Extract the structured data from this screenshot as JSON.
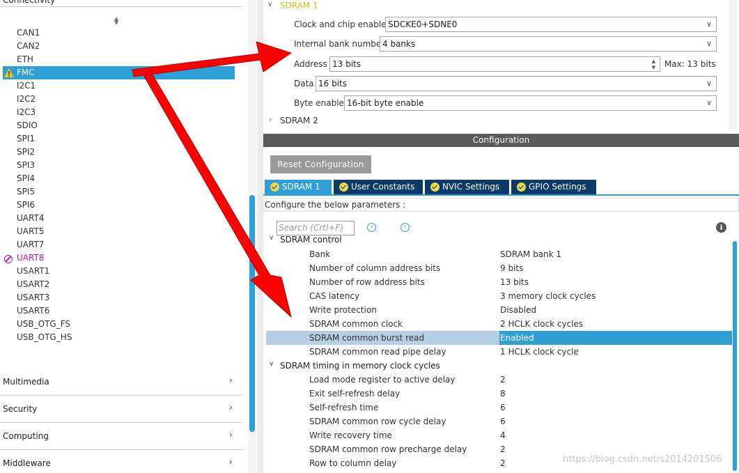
{
  "sidebar": {
    "category_top": "Connectivity",
    "peripherals": [
      "CAN1",
      "CAN2",
      "ETH",
      "FMC",
      "I2C1",
      "I2C2",
      "I2C3",
      "SDIO",
      "SPI1",
      "SPI2",
      "SPI3",
      "SPI4",
      "SPI5",
      "SPI6",
      "UART4",
      "UART5",
      "UART7",
      "UART8",
      "USART1",
      "USART2",
      "USART3",
      "USART6",
      "USB_OTG_FS",
      "USB_OTG_HS"
    ],
    "selected": "FMC",
    "warning_item": "FMC",
    "disabled_item": "UART8",
    "categories": [
      "Multimedia",
      "Security",
      "Computing",
      "Middleware"
    ]
  },
  "sdram1_panel": {
    "title": "SDRAM 1",
    "fields": [
      {
        "label": "Clock and chip enable",
        "value": "SDCKE0+SDNE0",
        "type": "dropdown"
      },
      {
        "label": "Internal bank number",
        "value": "4 banks",
        "type": "dropdown"
      },
      {
        "label": "Address",
        "value": "13 bits",
        "type": "spinner",
        "suffix": "Max: 13 bits"
      },
      {
        "label": "Data",
        "value": "16 bits",
        "type": "dropdown"
      },
      {
        "label": "Byte enable",
        "value": "16-bit byte enable",
        "type": "dropdown"
      }
    ],
    "next_title": "SDRAM 2"
  },
  "config": {
    "header": "Configuration",
    "reset_button": "Reset Configuration",
    "tabs": [
      "SDRAM 1",
      "User Constants",
      "NVIC Settings",
      "GPIO Settings"
    ],
    "active_tab": "SDRAM 1",
    "hint": "Configure the below parameters :",
    "search_placeholder": "Search (Crtl+F)"
  },
  "params": {
    "section1": "SDRAM control",
    "rows1": [
      {
        "name": "Bank",
        "value": "SDRAM bank 1"
      },
      {
        "name": "Number of column address bits",
        "value": "9 bits"
      },
      {
        "name": "Number of row address bits",
        "value": "13 bits"
      },
      {
        "name": "CAS latency",
        "value": "3 memory clock cycles"
      },
      {
        "name": "Write protection",
        "value": "Disabled"
      },
      {
        "name": "SDRAM common clock",
        "value": "2 HCLK clock cycles"
      },
      {
        "name": "SDRAM common burst read",
        "value": "Enabled"
      },
      {
        "name": "SDRAM common read pipe delay",
        "value": "1 HCLK clock cycle"
      }
    ],
    "section2": "SDRAM timing in memory clock cycles",
    "rows2": [
      {
        "name": "Load mode register to active delay",
        "value": "2"
      },
      {
        "name": "Exit self-refresh delay",
        "value": "8"
      },
      {
        "name": "Self-refresh time",
        "value": "6"
      },
      {
        "name": "SDRAM common row cycle delay",
        "value": "6"
      },
      {
        "name": "Write recovery time",
        "value": "4"
      },
      {
        "name": "SDRAM common row precharge delay",
        "value": "2"
      },
      {
        "name": "Row to column delay",
        "value": "2"
      }
    ]
  },
  "watermark": "https://blog.csdn.net/s2014201506",
  "colors": {
    "accent": "#2f9fd8",
    "tab_dark": "#0b3a6a",
    "arrow": "#ff0000"
  }
}
